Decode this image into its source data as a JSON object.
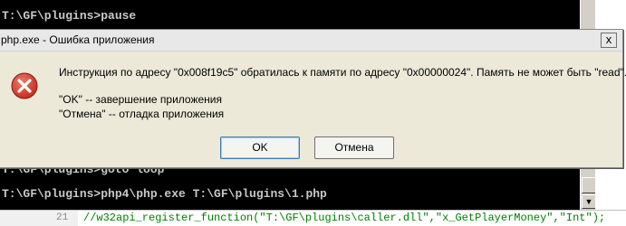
{
  "console": {
    "lines": [
      "T:\\GF\\plugins>pause",
      "T:\\GF\\plugins>goto loop",
      "T:\\GF\\plugins>php4\\php.exe T:\\GF\\plugins\\1.php"
    ]
  },
  "editor": {
    "line_number": "21",
    "code": "//w32api_register_function(\"T:\\GF\\plugins\\caller.dll\",\"x_GetPlayerMoney\",\"Int\");"
  },
  "dialog": {
    "title": "php.exe - Ошибка приложения",
    "close_glyph": "x",
    "icon": "error-icon",
    "message": "Инструкция по адресу \"0x008f19c5\" обратилась к памяти по адресу \"0x00000024\". Память не может быть \"read\".",
    "ok_hint": "\"OK\" -- завершение приложения",
    "cancel_hint": "\"Отмена\" -- отладка приложения",
    "ok_label": "OK",
    "cancel_label": "Отмена"
  },
  "scrollbar": {
    "down_glyph": "▼"
  },
  "colors": {
    "error_red": "#d9362b",
    "console_bg": "#000000"
  }
}
